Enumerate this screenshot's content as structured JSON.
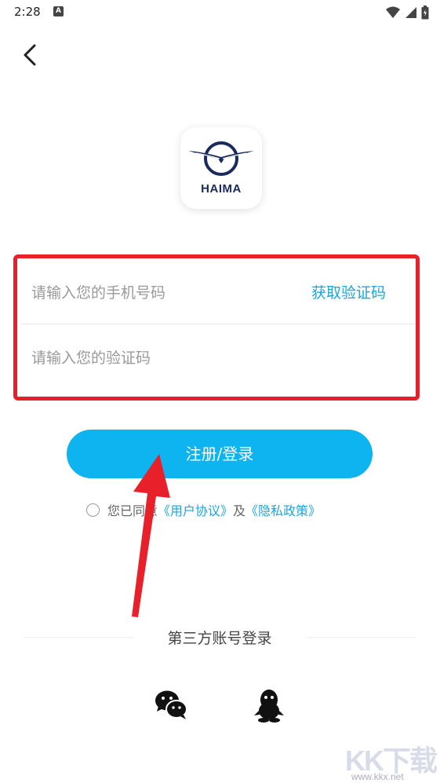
{
  "status_bar": {
    "time": "2:28",
    "notification_icon": "A"
  },
  "brand": {
    "logo_text": "HAIMA",
    "accent_color": "#0db4f0"
  },
  "form": {
    "phone_placeholder": "请输入您的手机号码",
    "get_code_label": "获取验证码",
    "code_placeholder": "请输入您的验证码"
  },
  "login_button_label": "注册/登录",
  "agreement": {
    "prefix": "您已同意",
    "user_agreement": "《用户协议》",
    "and": "及",
    "privacy_policy": "《隐私政策》"
  },
  "third_party": {
    "title": "第三方账号登录"
  },
  "watermark": {
    "text": "KK下载",
    "url": "www.kkx.net"
  },
  "icons": [
    "back-arrow-icon",
    "wifi-icon",
    "signal-icon",
    "battery-icon",
    "wechat-icon",
    "qq-icon"
  ]
}
